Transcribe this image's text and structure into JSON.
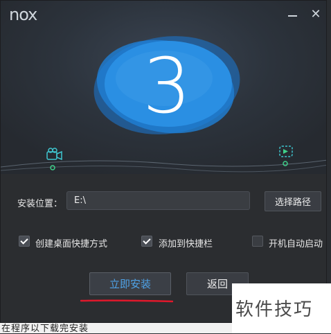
{
  "window": {
    "logo": "nox"
  },
  "countdown": {
    "value": "3"
  },
  "install": {
    "location_label": "安装位置：",
    "path_value": "E:\\",
    "choose_path_label": "选择路径"
  },
  "options": [
    {
      "label": "创建桌面快捷方式",
      "checked": true
    },
    {
      "label": "添加到快捷栏",
      "checked": true
    },
    {
      "label": "开机自动启动",
      "checked": false
    }
  ],
  "actions": {
    "install_label": "立即安装",
    "back_label": "返回"
  },
  "background": {
    "bottom_text": "在程序以下载完安装"
  },
  "watermark": {
    "text": "软件技巧"
  },
  "colors": {
    "accent": "#4fa3e8",
    "blob": "#1f80d6",
    "highlight_underline": "#e0182b"
  }
}
